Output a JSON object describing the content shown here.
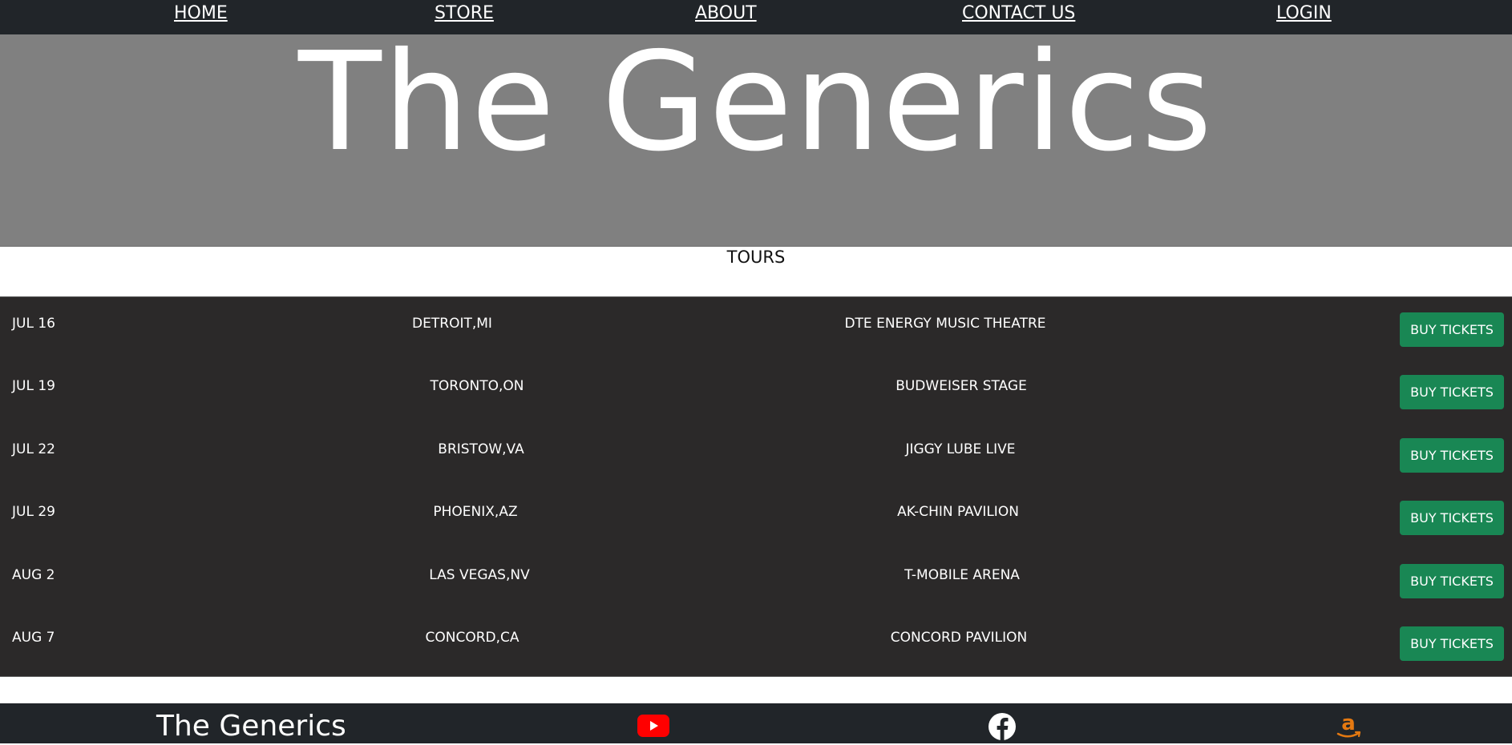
{
  "nav": {
    "home": "HOME",
    "store": "STORE",
    "about": "ABOUT",
    "contact": "CONTACT US",
    "login": "LOGIN"
  },
  "hero": {
    "title": "The Generics"
  },
  "tours": {
    "heading": "TOURS",
    "button_label": "BUY TICKETS",
    "rows": [
      {
        "date": "JUL 16",
        "city": "DETROIT,MI",
        "venue": "DTE ENERGY MUSIC THEATRE",
        "button": "BUY TICKETS"
      },
      {
        "date": "JUL 19",
        "city": "TORONTO,ON",
        "venue": "BUDWEISER STAGE",
        "button": "BUY TICKETS"
      },
      {
        "date": "JUL 22",
        "city": "BRISTOW,VA",
        "venue": "JIGGY LUBE LIVE",
        "button": "BUY TICKETS"
      },
      {
        "date": "JUL 29",
        "city": "PHOENIX,AZ",
        "venue": "AK-CHIN PAVILION",
        "button": "BUY TICKETS"
      },
      {
        "date": "AUG 2",
        "city": "LAS VEGAS,NV",
        "venue": "T-MOBILE ARENA",
        "button": "BUY TICKETS"
      },
      {
        "date": "AUG 7",
        "city": "CONCORD,CA",
        "venue": "CONCORD PAVILION",
        "button": "BUY TICKETS"
      }
    ]
  },
  "footer": {
    "brand": "The Generics",
    "icons": [
      "youtube-icon",
      "facebook-icon",
      "amazon-icon"
    ]
  },
  "colors": {
    "nav_bg": "#212529",
    "hero_bg": "#808080",
    "table_bg": "#2b2929",
    "button_bg": "#198754",
    "youtube": "#ff0000",
    "amazon": "#e47911"
  }
}
